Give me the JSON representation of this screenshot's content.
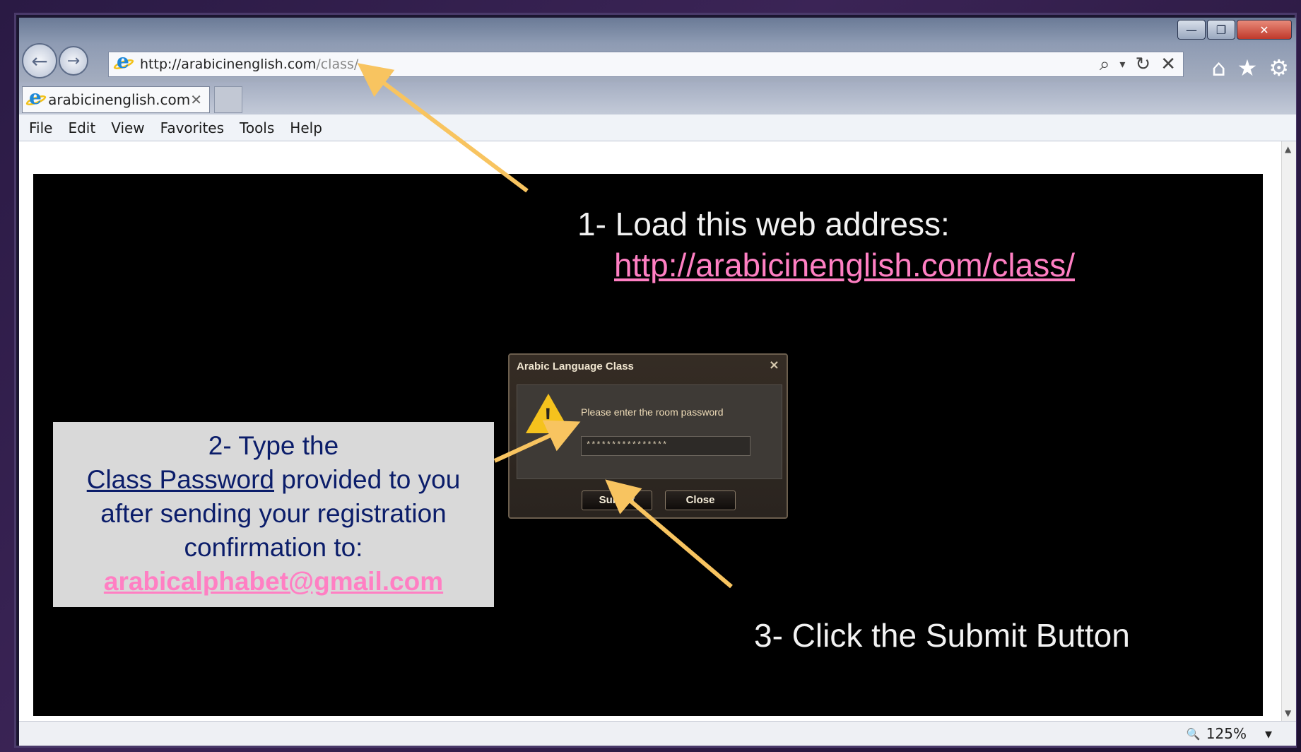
{
  "window": {
    "controls": {
      "minimize": "—",
      "restore": "❐",
      "close": "✕"
    }
  },
  "toolbar": {
    "back_icon": "←",
    "forward_icon": "→",
    "address_host": "http://arabicinenglish.com",
    "address_path": "/class/",
    "search_icon": "⌕",
    "dropdown_icon": "▾",
    "refresh_icon": "↻",
    "stop_icon": "✕",
    "home_icon": "⌂",
    "favorites_icon": "★",
    "tools_icon": "⚙"
  },
  "tab": {
    "title": "arabicinenglish.com",
    "close": "✕"
  },
  "menu": [
    "File",
    "Edit",
    "View",
    "Favorites",
    "Tools",
    "Help"
  ],
  "slide": {
    "step1_text": "1- Load this web address:",
    "step1_link": "http://arabicinenglish.com/class/",
    "step2_line1": "2- Type the",
    "step2_link": "Class Password",
    "step2_line2": " provided to you",
    "step2_line3": "after sending your registration",
    "step2_line4": "confirmation to:",
    "step2_email": "arabicalphabet@gmail.com",
    "step3_text": "3- Click the Submit Button"
  },
  "dialog": {
    "title": "Arabic Language Class",
    "close_icon": "×",
    "message": "Please enter the room password",
    "password_value": "****************",
    "submit_label": "Submit",
    "close_label": "Close"
  },
  "status": {
    "zoom": "125%",
    "zoom_icon": "🔍",
    "zoom_dropdown": "▾"
  },
  "colors": {
    "arrow": "#f8c460",
    "link_pink": "#ff7fc3",
    "slide_bg": "#000000",
    "note_bg": "#d9d9d9",
    "note_text": "#0b1d6a"
  }
}
